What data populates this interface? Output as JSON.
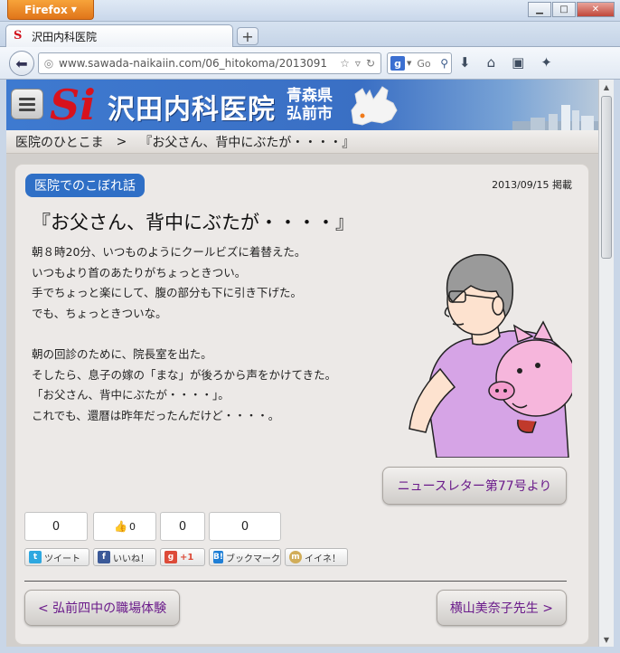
{
  "browser": {
    "app_button": "Firefox",
    "tab_title": "沢田内科医院",
    "url": "www.sawada-naikaiin.com/06_hitokoma/2013091",
    "search_placeholder": "Go"
  },
  "site": {
    "logo_mark": "Si",
    "name": "沢田内科医院",
    "location_line1": "青森県",
    "location_line2": "弘前市"
  },
  "breadcrumb": {
    "section": "医院のひとこま",
    "separator": ">",
    "current": "『お父さん、背中にぶたが・・・・』"
  },
  "post": {
    "category": "医院でのこぼれ話",
    "date": "2013/09/15 掲載",
    "title": "『お父さん、背中にぶたが・・・・』",
    "paragraph1": [
      "朝８時20分、いつものようにクールビズに着替えた。",
      "いつもより首のあたりがちょっときつい。",
      "手でちょっと楽にして、腹の部分も下に引き下げた。",
      "でも、ちょっときついな。"
    ],
    "paragraph2": [
      "朝の回診のために、院長室を出た。",
      "そしたら、息子の嫁の「まな」が後ろから声をかけてきた。",
      "「お父さん、背中にぶたが・・・・」。",
      "これでも、還暦は昨年だったんだけど・・・・。"
    ],
    "source_button": "ニュースレター第77号より"
  },
  "social": {
    "counts": {
      "tweet": "0",
      "like": "0",
      "gplus": "0",
      "hatena": "0"
    },
    "tweet_label": "ツイート",
    "like_label": "いいね！",
    "gplus_label": "+1",
    "hatena_label": "ブックマーク",
    "mixi_label": "イイネ！"
  },
  "pager": {
    "prev": "< 弘前四中の職場体験",
    "next": "横山美奈子先生 >"
  },
  "colors": {
    "header_blue": "#3a6fc4",
    "badge_blue": "#2f6fc6",
    "logo_red": "#d8121d",
    "link_purple": "#6a1a8a",
    "shirt_lavender": "#d6a4e6",
    "pig_pink": "#f6b6dc"
  }
}
